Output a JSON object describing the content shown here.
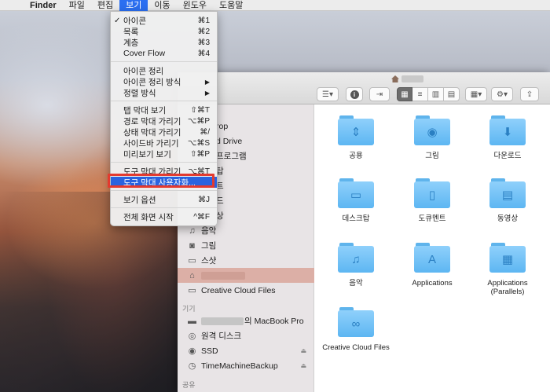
{
  "menubar": {
    "apple_icon": "",
    "items": [
      "Finder",
      "파일",
      "편집",
      "보기",
      "이동",
      "윈도우",
      "도움말"
    ],
    "active_index": 3
  },
  "view_menu": {
    "items": [
      {
        "label": "아이콘",
        "shortcut": "⌘1",
        "checked": true
      },
      {
        "label": "목록",
        "shortcut": "⌘2"
      },
      {
        "label": "계층",
        "shortcut": "⌘3"
      },
      {
        "label": "Cover Flow",
        "shortcut": "⌘4"
      },
      {
        "label": "아이콘 정리",
        "shortcut": ""
      },
      {
        "label": "아이콘 정리 방식",
        "submenu": true
      },
      {
        "label": "정렬 방식",
        "submenu": true
      },
      {
        "label": "탭 막대 보기",
        "shortcut": "⇧⌘T"
      },
      {
        "label": "경로 막대 가리기",
        "shortcut": "⌥⌘P"
      },
      {
        "label": "상태 막대 가리기",
        "shortcut": "⌘/"
      },
      {
        "label": "사이드바 가리기",
        "shortcut": "⌥⌘S"
      },
      {
        "label": "미리보기 보기",
        "shortcut": "⇧⌘P"
      },
      {
        "label": "도구 막대 가리기",
        "shortcut": "⌥⌘T"
      },
      {
        "label": "도구 막대 사용자화...",
        "shortcut": "",
        "highlighted": true
      },
      {
        "label": "보기 옵션",
        "shortcut": "⌘J"
      },
      {
        "label": "전체 화면 시작",
        "shortcut": "^⌘F"
      }
    ]
  },
  "sidebar": {
    "partial_items": [
      "rop",
      "d Drive",
      "프로그램",
      "탑",
      "트",
      "드",
      "상"
    ],
    "items": [
      {
        "label": "음악",
        "icon": "music-icon"
      },
      {
        "label": "그림",
        "icon": "camera-icon"
      },
      {
        "label": "스샷",
        "icon": "folder-icon"
      },
      {
        "label": "",
        "icon": "home-icon",
        "selected": true
      },
      {
        "label": "Creative Cloud Files",
        "icon": "folder-icon"
      }
    ],
    "devices_header": "기기",
    "devices": [
      {
        "label": "의 MacBook Pro",
        "icon": "laptop-icon"
      },
      {
        "label": "원격 디스크",
        "icon": "disc-icon"
      },
      {
        "label": "SSD",
        "icon": "disk-icon",
        "eject": true
      },
      {
        "label": "TimeMachineBackup",
        "icon": "timemachine-icon",
        "eject": true
      }
    ],
    "shared_header": "공유",
    "eject_glyph": "⏏"
  },
  "folders": [
    {
      "label": "공용",
      "glyph": "⇕"
    },
    {
      "label": "그림",
      "glyph": "◉"
    },
    {
      "label": "다운로드",
      "glyph": "⬇"
    },
    {
      "label": "데스크탑",
      "glyph": "▭"
    },
    {
      "label": "도큐멘트",
      "glyph": "▯"
    },
    {
      "label": "동영상",
      "glyph": "▤"
    },
    {
      "label": "음악",
      "glyph": "♫"
    },
    {
      "label": "Applications",
      "glyph": "A"
    },
    {
      "label": "Applications\n(Parallels)",
      "glyph": "▦"
    },
    {
      "label": "Creative Cloud Files",
      "glyph": "∞"
    }
  ],
  "colors": {
    "menu_highlight": "#2a63df",
    "callout": "#e33a2f",
    "folder_blue": "#5db6f2",
    "sidebar_selected": "#dcafa6"
  }
}
